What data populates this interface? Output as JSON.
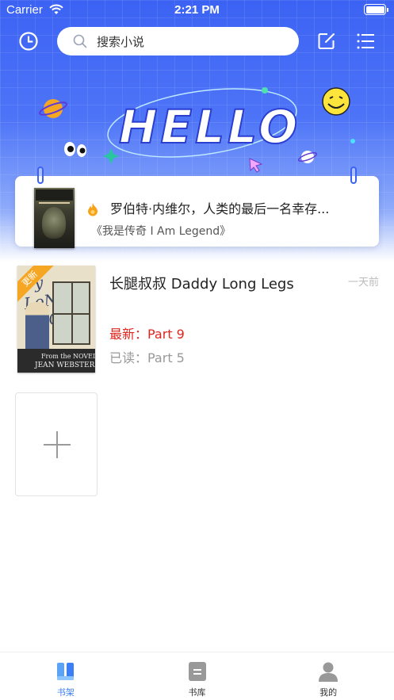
{
  "status_bar": {
    "carrier": "Carrier",
    "time": "2:21 PM"
  },
  "header": {
    "search_placeholder": "搜索小说",
    "icons": [
      "history-icon",
      "search-icon",
      "edit-icon",
      "list-icon"
    ]
  },
  "banner": {
    "hello_text": "HELLO"
  },
  "recommend": {
    "title": "罗伯特·内维尔，人类的最后一名幸存...",
    "book": "《我是传奇 I Am Legend》",
    "icon": "flame-icon"
  },
  "bookshelf": {
    "books": [
      {
        "badge": "更新",
        "name": "长腿叔叔 Daddy Long Legs",
        "time": "一天前",
        "latest": "最新：Part 9",
        "read": "已读：Part 5",
        "cover_text": {
          "from": "From the NOVEL by",
          "author": "JEAN WEBSTER"
        }
      }
    ]
  },
  "tab_bar": {
    "tabs": [
      {
        "label": "书架",
        "icon": "bookshelf-icon",
        "active": true
      },
      {
        "label": "书库",
        "icon": "library-icon",
        "active": false
      },
      {
        "label": "我的",
        "icon": "profile-icon",
        "active": false
      }
    ]
  },
  "colors": {
    "primary": "#3c62f4",
    "tab_active": "#3c7ef5",
    "update_red": "#e0241e",
    "badge_orange": "#f5a623"
  }
}
